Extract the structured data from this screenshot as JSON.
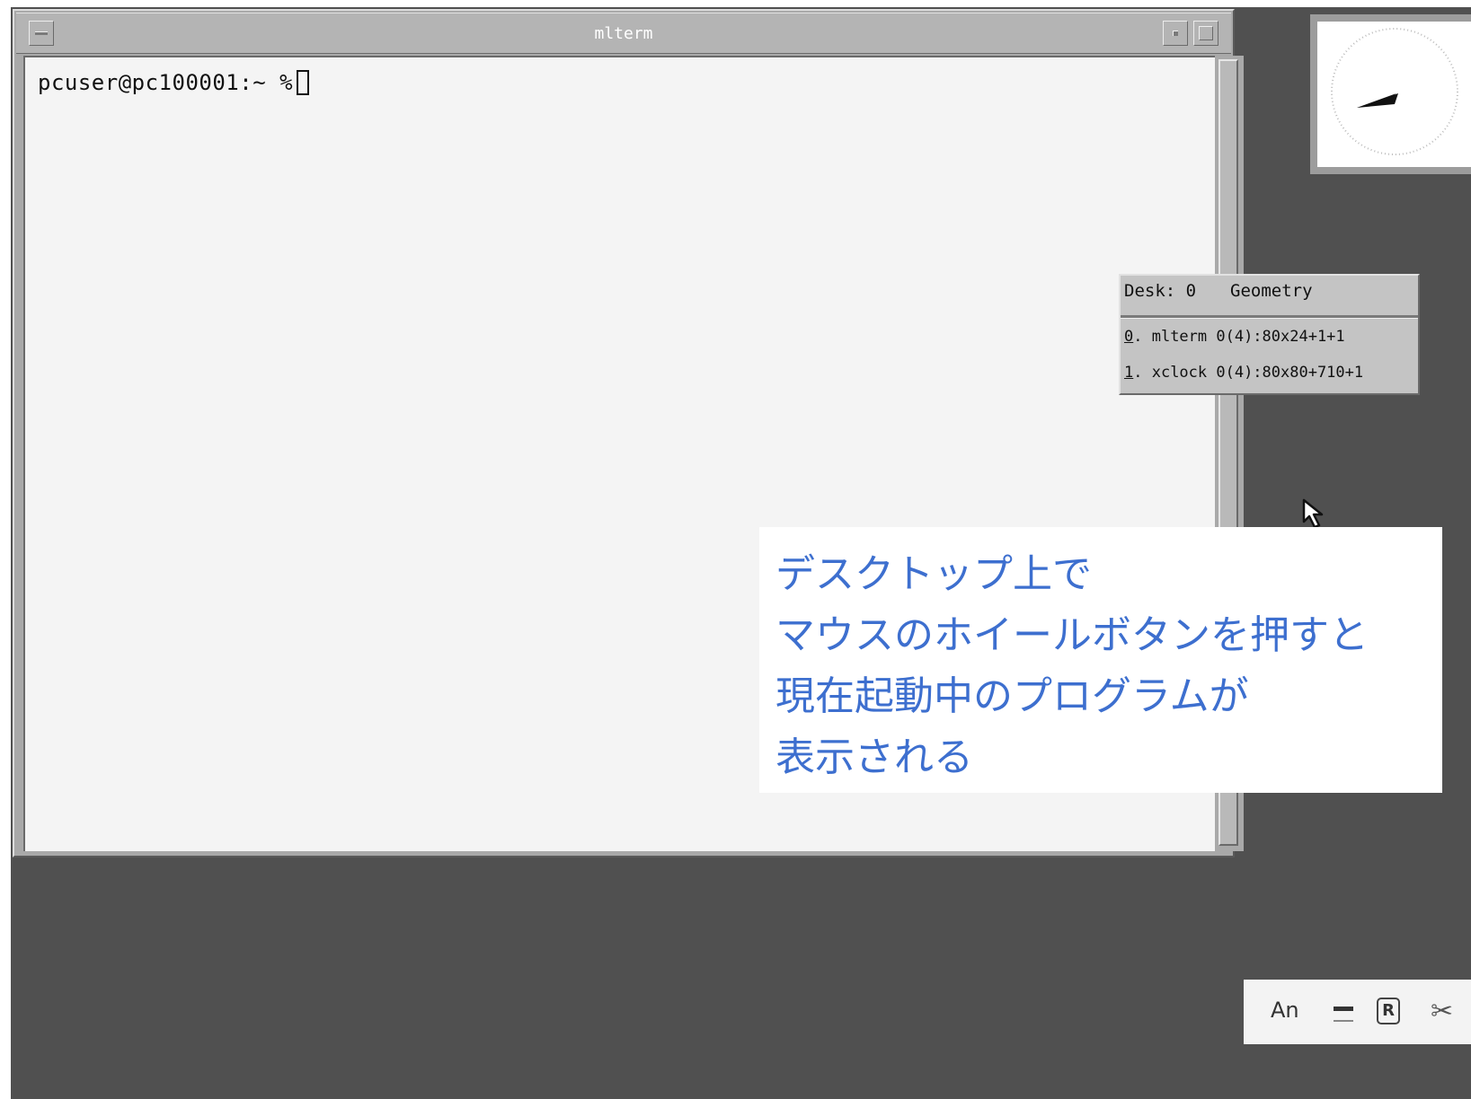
{
  "terminal": {
    "title": "mlterm",
    "prompt": "pcuser@pc100001:~ %"
  },
  "window_list": {
    "desk_label": "Desk: 0",
    "geometry_label": "Geometry",
    "items": [
      {
        "key": "0",
        "text": ". mlterm 0(4):80x24+1+1"
      },
      {
        "key": "1",
        "text": ". xclock 0(4):80x80+710+1"
      }
    ]
  },
  "annotation": {
    "lines": [
      "デスクトップ上で",
      "マウスのホイールボタンを押すと",
      "現在起動中のプログラムが",
      "表示される"
    ],
    "color": "#3d6fcf"
  },
  "ime_toolbar": {
    "mode_label": "An",
    "r_label": "R",
    "tool_glyph": "✂"
  },
  "icons": {
    "window_menu": "window-menu-icon",
    "iconify": "iconify-icon",
    "maximize": "maximize-icon",
    "pointer": "mouse-pointer-icon",
    "clock": "analog-clock-icon",
    "tools": "tools-icon"
  },
  "colors": {
    "desktop": "#505050",
    "terminal_bg": "#f4f4f4",
    "frame": "#a9a9a9"
  }
}
